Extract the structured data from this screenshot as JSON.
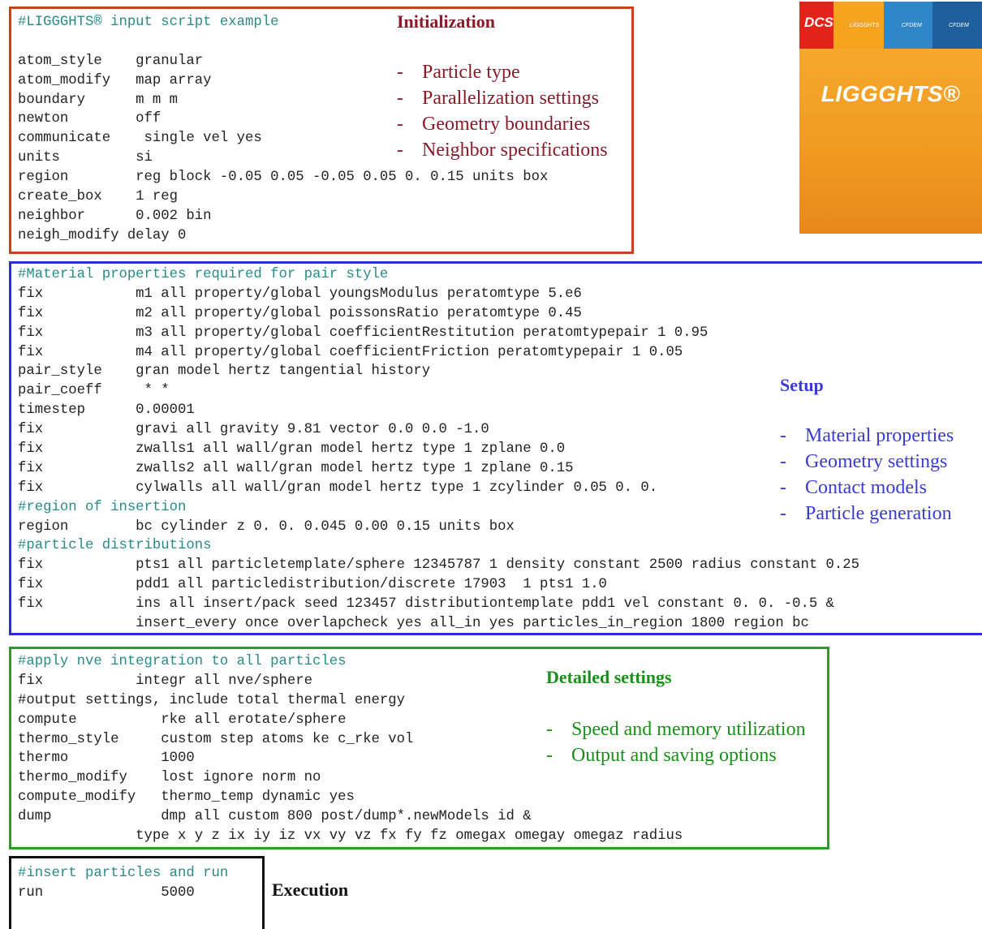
{
  "initialization": {
    "heading": "Initialization",
    "bullets": [
      "Particle type",
      "Parallelization settings",
      "Geometry boundaries",
      "Neighbor specifications"
    ],
    "code": [
      {
        "text": "#LIGGGHTS® input script example",
        "comment": true
      },
      {
        "text": "",
        "comment": false
      },
      {
        "text": "atom_style    granular",
        "comment": false
      },
      {
        "text": "atom_modify   map array",
        "comment": false
      },
      {
        "text": "boundary      m m m",
        "comment": false
      },
      {
        "text": "newton        off",
        "comment": false
      },
      {
        "text": "communicate    single vel yes",
        "comment": false
      },
      {
        "text": "units         si",
        "comment": false
      },
      {
        "text": "region        reg block -0.05 0.05 -0.05 0.05 0. 0.15 units box",
        "comment": false
      },
      {
        "text": "create_box    1 reg",
        "comment": false
      },
      {
        "text": "neighbor      0.002 bin",
        "comment": false
      },
      {
        "text": "neigh_modify delay 0",
        "comment": false
      }
    ]
  },
  "setup": {
    "heading": "Setup",
    "bullets": [
      "Material properties",
      "Geometry settings",
      "Contact models",
      "Particle generation"
    ],
    "code": [
      {
        "text": "#Material properties required for pair style",
        "comment": true
      },
      {
        "text": "fix           m1 all property/global youngsModulus peratomtype 5.e6",
        "comment": false
      },
      {
        "text": "fix           m2 all property/global poissonsRatio peratomtype 0.45",
        "comment": false
      },
      {
        "text": "fix           m3 all property/global coefficientRestitution peratomtypepair 1 0.95",
        "comment": false
      },
      {
        "text": "fix           m4 all property/global coefficientFriction peratomtypepair 1 0.05",
        "comment": false
      },
      {
        "text": "pair_style    gran model hertz tangential history",
        "comment": false
      },
      {
        "text": "pair_coeff     * *",
        "comment": false
      },
      {
        "text": "timestep      0.00001",
        "comment": false
      },
      {
        "text": "fix           gravi all gravity 9.81 vector 0.0 0.0 -1.0",
        "comment": false
      },
      {
        "text": "fix           zwalls1 all wall/gran model hertz type 1 zplane 0.0",
        "comment": false
      },
      {
        "text": "fix           zwalls2 all wall/gran model hertz type 1 zplane 0.15",
        "comment": false
      },
      {
        "text": "fix           cylwalls all wall/gran model hertz type 1 zcylinder 0.05 0. 0.",
        "comment": false
      },
      {
        "text": "#region of insertion",
        "comment": true
      },
      {
        "text": "region        bc cylinder z 0. 0. 0.045 0.00 0.15 units box",
        "comment": false
      },
      {
        "text": "#particle distributions",
        "comment": true
      },
      {
        "text": "fix           pts1 all particletemplate/sphere 12345787 1 density constant 2500 radius constant 0.25",
        "comment": false
      },
      {
        "text": "fix           pdd1 all particledistribution/discrete 17903  1 pts1 1.0",
        "comment": false
      },
      {
        "text": "fix           ins all insert/pack seed 123457 distributiontemplate pdd1 vel constant 0. 0. -0.5 &",
        "comment": false
      },
      {
        "text": "              insert_every once overlapcheck yes all_in yes particles_in_region 1800 region bc",
        "comment": false
      }
    ]
  },
  "detailed": {
    "heading": "Detailed settings",
    "bullets": [
      "Speed and memory utilization",
      "Output and saving options"
    ],
    "code": [
      {
        "text": "#apply nve integration to all particles",
        "comment": true
      },
      {
        "text": "fix           integr all nve/sphere",
        "comment": false
      },
      {
        "text": "#output settings, include total thermal energy",
        "comment": false
      },
      {
        "text": "compute          rke all erotate/sphere",
        "comment": false
      },
      {
        "text": "thermo_style     custom step atoms ke c_rke vol",
        "comment": false
      },
      {
        "text": "thermo           1000",
        "comment": false
      },
      {
        "text": "thermo_modify    lost ignore norm no",
        "comment": false
      },
      {
        "text": "compute_modify   thermo_temp dynamic yes",
        "comment": false
      },
      {
        "text": "dump             dmp all custom 800 post/dump*.newModels id &",
        "comment": false
      },
      {
        "text": "              type x y z ix iy iz vx vy vz fx fy fz omegax omegay omegaz radius",
        "comment": false
      }
    ]
  },
  "execution": {
    "heading": "Execution",
    "code": [
      {
        "text": "#insert particles and run",
        "comment": true
      },
      {
        "text": "run              5000",
        "comment": false
      }
    ]
  },
  "logo": {
    "wordmark": "LIGGGHTS®",
    "tabs": [
      "DCS",
      "LIGGGHTS",
      "CFDEM",
      "CFDEM"
    ],
    "colors": [
      "#e2231a",
      "#f6a31e",
      "#2f87c8",
      "#1f5f9e"
    ]
  }
}
